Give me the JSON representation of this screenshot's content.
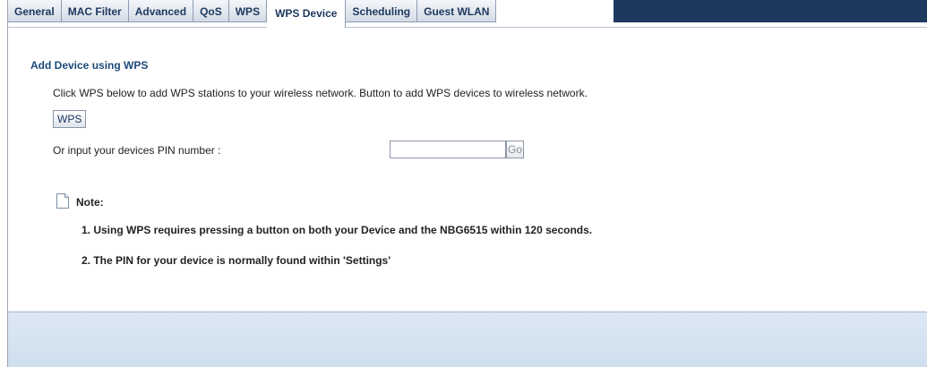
{
  "tabs": [
    {
      "label": "General",
      "active": false
    },
    {
      "label": "MAC Filter",
      "active": false
    },
    {
      "label": "Advanced",
      "active": false
    },
    {
      "label": "QoS",
      "active": false
    },
    {
      "label": "WPS",
      "active": false
    },
    {
      "label": "WPS Device",
      "active": true
    },
    {
      "label": "Scheduling",
      "active": false
    },
    {
      "label": "Guest WLAN",
      "active": false
    }
  ],
  "section": {
    "title": "Add Device using WPS",
    "description": "Click WPS below to add WPS stations to your wireless network. Button to add WPS devices to wireless network."
  },
  "wps_button": {
    "label": "WPS"
  },
  "pin": {
    "label": "Or input your devices PIN number :",
    "value": "",
    "go_label": "Go"
  },
  "note": {
    "label": "Note:",
    "icon": "document-icon",
    "items": [
      "1. Using WPS requires pressing a button on both your Device and the NBG6515 within 120 seconds.",
      "2. The PIN for your device is normally found within 'Settings'"
    ]
  },
  "colors": {
    "tab_bar_fill": "#1d3960",
    "title_blue": "#1d4a7a",
    "footer_bar": "#d6e4f2"
  }
}
